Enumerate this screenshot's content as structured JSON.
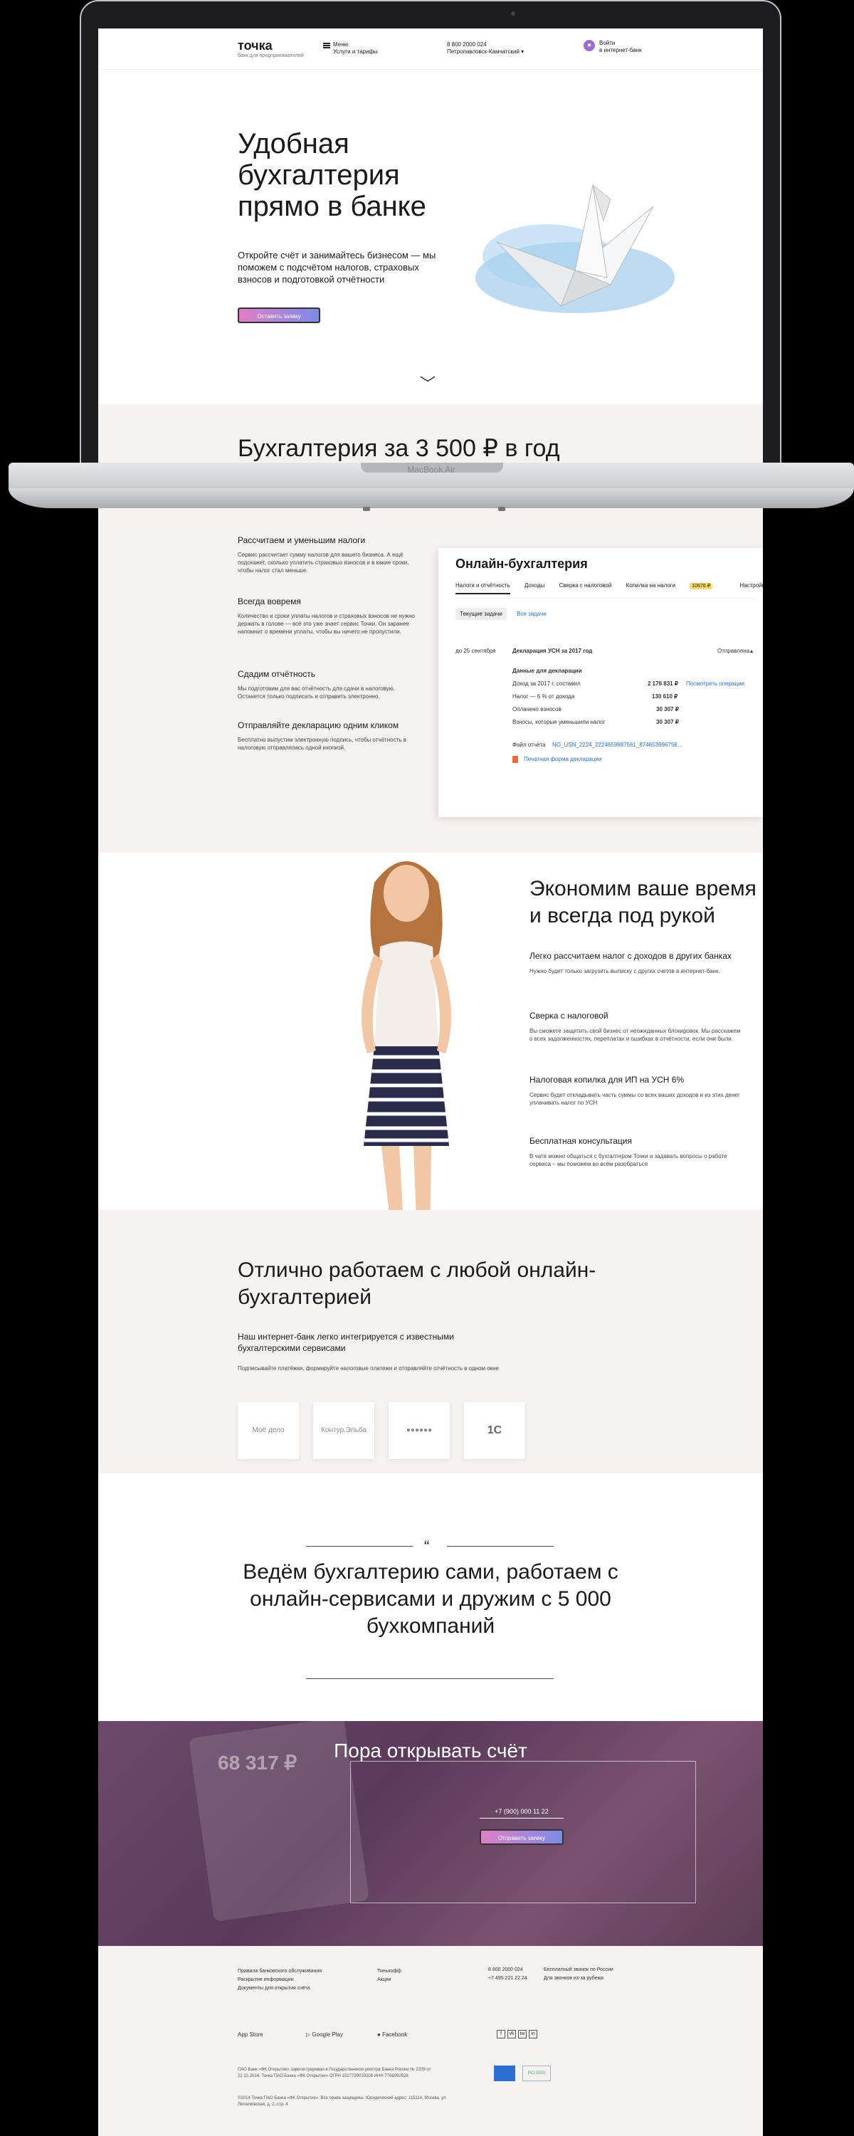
{
  "laptop": {
    "model_label": "MacBook Air"
  },
  "header": {
    "logo": "точка",
    "logo_sub": "банк для предпринимателей",
    "menu_title": "Меню",
    "menu_sub": "Услуги и тарифы",
    "phone": "8 800 2000 024",
    "city": "Петропавловск-Камчатский",
    "login_title": "Войти",
    "login_sub": "в интернет-банк"
  },
  "hero": {
    "title": "Удобная бухгалтерия прямо в банке",
    "subtitle": "Откройте счёт и занимайтесь бизнесом — мы поможем с подсчётом налогов, страховых взносов и подготовкой отчётности",
    "button": "Оставить заявку"
  },
  "accounting": {
    "title": "Бухгалтерия за 3 500 ₽ в год",
    "features": [
      {
        "title": "Рассчитаем и уменьшим налоги",
        "text": "Сервис рассчитает сумму налогов для вашего бизнеса. А ещё подскажет, сколько уплатить страховых взносов и в какие сроки, чтобы налог стал меньше."
      },
      {
        "title": "Всегда вовремя",
        "text": "Количество и сроки уплаты налогов и страховых взносов не нужно держать в голове — всё это уже знает сервис Точки. Он заранее напомнит о времени уплаты, чтобы вы ничего не пропустили."
      },
      {
        "title": "Сдадим отчётность",
        "text": "Мы подготовим для вас отчётность для сдачи в налоговую. Останется только подписать и отправить электронно."
      },
      {
        "title": "Отправляйте декларацию одним кликом",
        "text": "Бесплатно выпустим электронную подпись, чтобы отчётность в налоговую отправлялась одной кнопкой."
      }
    ],
    "card": {
      "title": "Онлайн-бухгалтерия",
      "tabs": [
        "Налоги и отчётность",
        "Доходы",
        "Сверка с налоговой",
        "Копилка на налоги",
        "Настройки"
      ],
      "tab_tag": "10676 ₽",
      "subtabs": [
        "Текущие задачи",
        "Все задачи"
      ],
      "task_date": "до 25 сентября",
      "task_name": "Декларация УСН за 2017 год",
      "task_status": "Отправлена",
      "data_header": "Данные для декларации",
      "rows": [
        {
          "label": "Доход за 2017 г. составил",
          "value": "2 176 831 ₽",
          "link": "Посмотреть операции"
        },
        {
          "label": "Налог — 6 % от дохода",
          "value": "130 610 ₽",
          "link": ""
        },
        {
          "label": "Оплачено взносов",
          "value": "30 307 ₽",
          "link": ""
        },
        {
          "label": "Взносы, которые уменьшили налог",
          "value": "30 307 ₽",
          "link": ""
        }
      ],
      "file_label": "Файл отчёта",
      "file_name": "NO_USN_2224_2224659987561_874653996756...",
      "print_link": "Печатная форма декларации"
    }
  },
  "savings": {
    "title": "Экономим ваше время и всегда под рукой",
    "items": [
      {
        "title": "Легко рассчитаем налог с доходов в других банках",
        "text": "Нужно будет только загрузить выписку с других счетов в интернет-банк."
      },
      {
        "title": "Сверка с налоговой",
        "text": "Вы сможете защитить свой бизнес от неожиданных блокировок. Мы расскажем о всех задолженностях, переплатах и ошибках в отчётности, если они были."
      },
      {
        "title": "Налоговая копилка для ИП на УСН 6%",
        "text": "Сервис будет откладывать часть суммы со всех ваших доходов и из этих денег уплачивать налог по УСН"
      },
      {
        "title": "Бесплатная консультация",
        "text": "В чате можно общаться с бухгалтером Точки и задавать вопросы о работе сервиса – мы поможем во всём разобраться"
      }
    ]
  },
  "integration": {
    "title": "Отлично работаем с любой онлайн-бухгалтерией",
    "subtitle": "Наш интернет-банк легко интегрируется с известными бухгалтерскими сервисами",
    "note": "Подписывайте платёжки, формируйте налоговые платежи и отправляйте отчётность в одном окне",
    "partners": [
      "Моё дело",
      "Контур.Эльба",
      "●●●●●●",
      "1С"
    ]
  },
  "quote": {
    "mark": "“",
    "text": "Ведём бухгалтерию сами, работаем с онлайн-сервисами и дружим с 5 000 бухкомпаний"
  },
  "cta": {
    "title": "Пора открывать счёт",
    "phone": "+7 (900) 000 11 22",
    "button": "Отправить заявку",
    "tablet_number": "68 317 ₽"
  },
  "footer": {
    "col1": [
      "Правила банковского обслуживания",
      "Раскрытие информации",
      "Документы для открытия счёта"
    ],
    "col2": [
      "Тинькофф",
      "Акции"
    ],
    "col3": [
      "8 800 2000 024",
      "+7 495 221 22 24"
    ],
    "col4": [
      "Бесплатный звонок по России",
      "Для звонков из-за рубежа"
    ],
    "stores": [
      "App Store",
      "Google Play",
      "Facebook"
    ],
    "social": [
      "f",
      "vk",
      "tw",
      "in"
    ],
    "legal1": "ПАО Банк «ФК Открытие» зарегистрирован в Государственном реестре Банка России № 2209 от 22.12.2014. Точка ПАО Банка «ФК Открытие» ОГРН 1027739019208 ИНН 7706092528",
    "legal2": "©2014 Точка ПАО Банка «ФК Открытие». Все права защищены. Юридический адрес: 115114, Москва, ул. Летниковская, д. 2, стр. 4",
    "badge_text": "PCI DSS"
  }
}
